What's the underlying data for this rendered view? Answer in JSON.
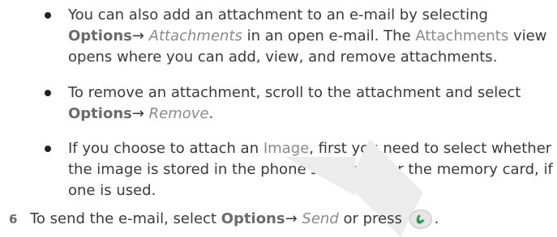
{
  "bullets": [
    {
      "lines": [
        {
          "t1": "You can also add an attachment to an e-mail by selecting"
        },
        {
          "opt": "Options",
          "arrow": "→ ",
          "menu": "Attachments",
          "t1": " in an open e-mail. The ",
          "view": "Attachments",
          "t2": " view"
        },
        {
          "t1": "opens where you can add, view, and remove attachments."
        }
      ]
    },
    {
      "lines": [
        {
          "t1": "To remove an attachment, scroll to the attachment and select"
        },
        {
          "opt": "Options",
          "arrow": "→ ",
          "menu": "Remove",
          "t1": "."
        }
      ]
    },
    {
      "lines": [
        {
          "t1": "If you choose to attach an ",
          "view": "Image",
          "t2": ", first you need to select whether"
        },
        {
          "t1": "the image is stored in the phone’s memory or the memory card, if"
        },
        {
          "t1": "one is used."
        }
      ]
    }
  ],
  "step": {
    "number": "6",
    "text_before": "To send the e-mail, select ",
    "opt": "Options",
    "arrow": "→ ",
    "menu": "Send",
    "text_after": " or press ",
    "end": "."
  },
  "icons": {
    "call_key": "call-key-icon",
    "watermark": "watermark-draft-mark"
  },
  "colors": {
    "body_text": "#3a3a3a",
    "emphasis": "#6b6b6b",
    "menu_item": "#8a8a8a",
    "call_key_green": "#2e9e4f",
    "watermark_gray": "#e9e9e9"
  }
}
